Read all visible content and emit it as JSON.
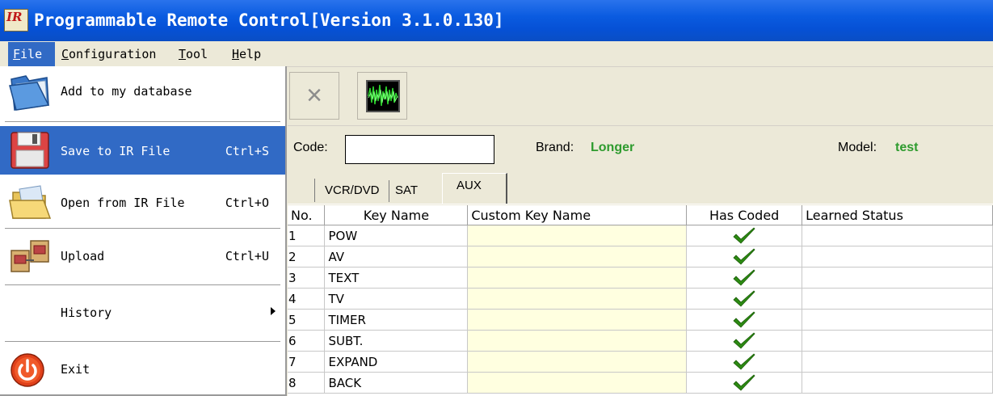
{
  "window": {
    "icon_text": "IR",
    "title": "Programmable Remote Control[Version 3.1.0.130]"
  },
  "menubar": {
    "file": "File",
    "file_ul": "F",
    "file_rest": "ile",
    "configuration_ul": "C",
    "configuration_rest": "onfiguration",
    "tool_ul": "T",
    "tool_rest": "ool",
    "help_ul": "H",
    "help_rest": "elp"
  },
  "file_menu": {
    "items": [
      {
        "label": "Add to my database",
        "shortcut": "",
        "icon": "folder-icon"
      },
      {
        "label": "Save to  IR File",
        "shortcut": "Ctrl+S",
        "icon": "save-icon"
      },
      {
        "label": "Open from IR File",
        "shortcut": "Ctrl+O",
        "icon": "open-folder-icon"
      },
      {
        "label": "Upload",
        "shortcut": "Ctrl+U",
        "icon": "upload-icon"
      },
      {
        "label": "History",
        "shortcut": "",
        "icon": ""
      },
      {
        "label": "Exit",
        "shortcut": "",
        "icon": "exit-icon"
      }
    ],
    "selected_index": 1
  },
  "toolbar": {
    "delete_icon": "×"
  },
  "info": {
    "code_label": "Code:",
    "code_value": "",
    "brand_label": "Brand:",
    "brand_value": "Longer",
    "model_label": "Model:",
    "model_value": "test",
    "value_color": "#2e9b2e"
  },
  "tabs": {
    "vcr": "VCR/DVD",
    "sat": "SAT",
    "aux": "AUX",
    "active": "AUX"
  },
  "table": {
    "headers": {
      "no": "No.",
      "key_name": "Key Name",
      "custom_key_name": "Custom Key Name",
      "has_coded": "Has Coded",
      "learned_status": "Learned Status"
    },
    "rows": [
      {
        "no": "1",
        "key": "POW",
        "custom": "",
        "coded": true,
        "learned": ""
      },
      {
        "no": "2",
        "key": "AV",
        "custom": "",
        "coded": true,
        "learned": ""
      },
      {
        "no": "3",
        "key": "TEXT",
        "custom": "",
        "coded": true,
        "learned": ""
      },
      {
        "no": "4",
        "key": "TV",
        "custom": "",
        "coded": true,
        "learned": ""
      },
      {
        "no": "5",
        "key": "TIMER",
        "custom": "",
        "coded": true,
        "learned": ""
      },
      {
        "no": "6",
        "key": "SUBT.",
        "custom": "",
        "coded": true,
        "learned": ""
      },
      {
        "no": "7",
        "key": "EXPAND",
        "custom": "",
        "coded": true,
        "learned": ""
      },
      {
        "no": "8",
        "key": "BACK",
        "custom": "",
        "coded": true,
        "learned": ""
      }
    ],
    "check_color": "#2c8a12",
    "custom_bg": "#ffffe0"
  }
}
